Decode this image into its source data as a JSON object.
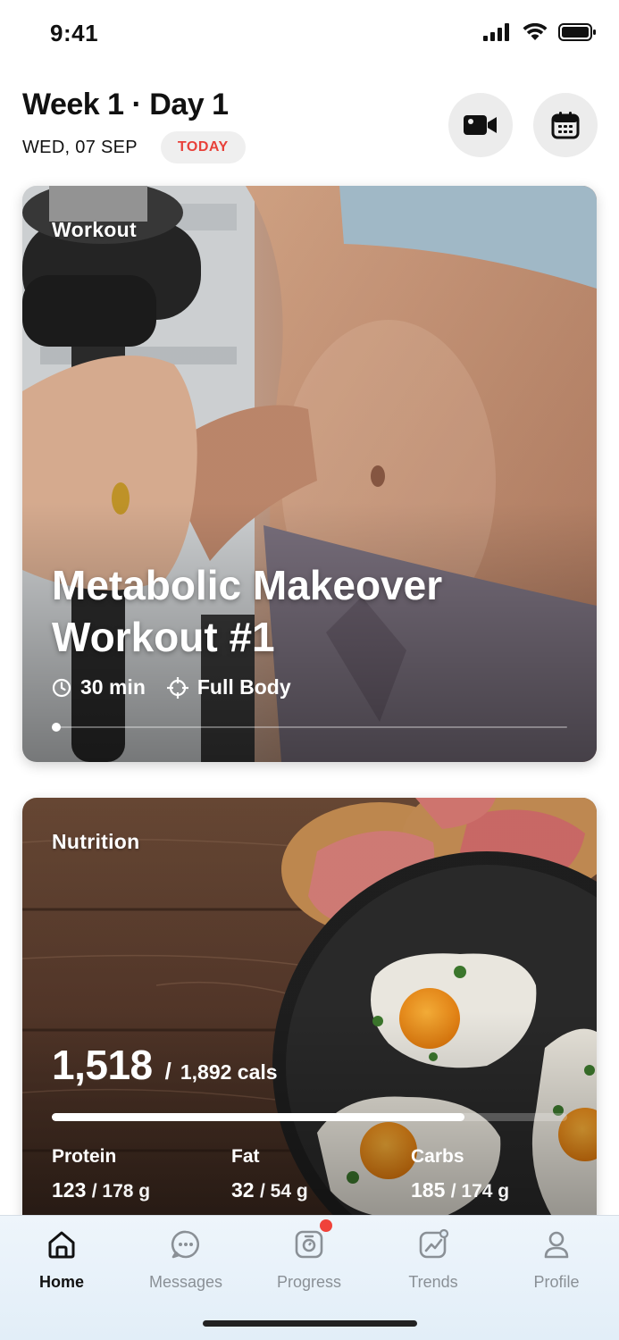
{
  "status_bar": {
    "time": "9:41"
  },
  "header": {
    "title": "Week 1 · Day 1",
    "date": "WED, 07 SEP",
    "today_badge": "TODAY",
    "video_button_icon": "video-camera-icon",
    "calendar_button_icon": "calendar-icon"
  },
  "workout_card": {
    "label": "Workout",
    "title": "Metabolic Makeover Workout #1",
    "duration": "30 min",
    "focus": "Full Body",
    "progress_fraction": 0
  },
  "nutrition_card": {
    "label": "Nutrition",
    "calories_consumed": "1,518",
    "calories_separator": "/",
    "calories_goal": "1,892 cals",
    "calories_fraction": 0.8,
    "macros": [
      {
        "label": "Protein",
        "value": "123",
        "goal": "/ 178 g"
      },
      {
        "label": "Fat",
        "value": "32",
        "goal": "/ 54 g"
      },
      {
        "label": "Carbs",
        "value": "185",
        "goal": "/ 174 g"
      }
    ]
  },
  "tab_bar": {
    "tabs": [
      {
        "label": "Home",
        "icon": "home-icon",
        "active": true
      },
      {
        "label": "Messages",
        "icon": "chat-bubble-icon",
        "active": false
      },
      {
        "label": "Progress",
        "icon": "progress-scale-icon",
        "active": false,
        "has_badge": true
      },
      {
        "label": "Trends",
        "icon": "trends-chart-icon",
        "active": false
      },
      {
        "label": "Profile",
        "icon": "profile-icon",
        "active": false
      }
    ]
  },
  "colors": {
    "accent_red": "#e8413a",
    "badge_red": "#f0423a",
    "tab_inactive": "#8a9096",
    "tab_active": "#111111"
  }
}
